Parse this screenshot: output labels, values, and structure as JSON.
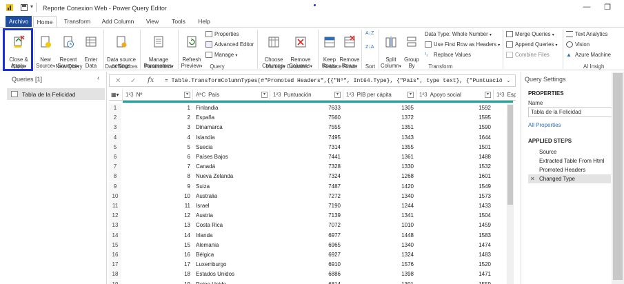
{
  "window": {
    "title": "Reporte Conexion Web - Power Query Editor"
  },
  "menu": {
    "tabs": [
      "Archivo",
      "Home",
      "Transform",
      "Add Column",
      "View",
      "Tools",
      "Help"
    ]
  },
  "ribbon": {
    "close_apply": "Close &\nApply",
    "new_source": "New\nSource",
    "recent_sources": "Recent\nSources",
    "enter_data": "Enter\nData",
    "data_source_settings": "Data source\nsettings",
    "manage_parameters": "Manage\nParameters",
    "refresh_preview": "Refresh\nPreview",
    "properties": "Properties",
    "advanced_editor": "Advanced Editor",
    "manage": "Manage",
    "choose_columns": "Choose\nColumns",
    "remove_columns": "Remove\nColumns",
    "keep_rows": "Keep\nRows",
    "remove_rows": "Remove\nRows",
    "split_column": "Split\nColumn",
    "group_by": "Group\nBy",
    "data_type": "Data Type: Whole Number",
    "use_first_row": "Use First Row as Headers",
    "replace_values": "Replace Values",
    "merge_queries": "Merge Queries",
    "append_queries": "Append Queries",
    "combine_files": "Combine Files",
    "text_analytics": "Text Analytics",
    "vision": "Vision",
    "azure_ml": "Azure Machine",
    "groups": {
      "close": "Close",
      "new_query": "New Query",
      "data_sources": "Data Sources",
      "parameters": "Parameters",
      "query": "Query",
      "manage_columns": "Manage Columns",
      "reduce_rows": "Reduce Rows",
      "sort": "Sort",
      "transform": "Transform",
      "ai_insights": "AI Insigh"
    }
  },
  "queries_pane": {
    "title": "Queries [1]",
    "items": [
      "Tabla de la Felicidad"
    ]
  },
  "formula_bar": {
    "formula": "= Table.TransformColumnTypes(#\"Promoted Headers\",{{\"Nº\", Int64.Type}, {\"País\", type text}, {\"Puntuación\","
  },
  "grid": {
    "columns": [
      {
        "type": "1²3",
        "name": "Nº"
      },
      {
        "type": "AᵇC",
        "name": "País"
      },
      {
        "type": "1²3",
        "name": "Puntuación"
      },
      {
        "type": "1²3",
        "name": "PIB per cápita"
      },
      {
        "type": "1²3",
        "name": "Apoyo social"
      },
      {
        "type": "1²3",
        "name": "Espe"
      }
    ],
    "rows": [
      [
        "1",
        "1",
        "Finlandia",
        "7633",
        "1305",
        "1592"
      ],
      [
        "2",
        "2",
        "España",
        "7560",
        "1372",
        "1595"
      ],
      [
        "3",
        "3",
        "Dinamarca",
        "7555",
        "1351",
        "1590"
      ],
      [
        "4",
        "4",
        "Islandia",
        "7495",
        "1343",
        "1644"
      ],
      [
        "5",
        "5",
        "Suecia",
        "7314",
        "1355",
        "1501"
      ],
      [
        "6",
        "6",
        "Países Bajos",
        "7441",
        "1361",
        "1488"
      ],
      [
        "7",
        "7",
        "Canadá",
        "7328",
        "1330",
        "1532"
      ],
      [
        "8",
        "8",
        "Nueva Zelanda",
        "7324",
        "1268",
        "1601"
      ],
      [
        "9",
        "9",
        "Suiza",
        "7487",
        "1420",
        "1549"
      ],
      [
        "10",
        "10",
        "Australia",
        "7272",
        "1340",
        "1573"
      ],
      [
        "11",
        "11",
        "Israel",
        "7190",
        "1244",
        "1433"
      ],
      [
        "12",
        "12",
        "Austria",
        "7139",
        "1341",
        "1504"
      ],
      [
        "13",
        "13",
        "Costa Rica",
        "7072",
        "1010",
        "1459"
      ],
      [
        "14",
        "14",
        "Irlanda",
        "6977",
        "1448",
        "1583"
      ],
      [
        "15",
        "15",
        "Alemania",
        "6965",
        "1340",
        "1474"
      ],
      [
        "16",
        "16",
        "Bélgica",
        "6927",
        "1324",
        "1483"
      ],
      [
        "17",
        "17",
        "Luxemburgo",
        "6910",
        "1576",
        "1520"
      ],
      [
        "18",
        "18",
        "Estados Unidos",
        "6886",
        "1398",
        "1471"
      ],
      [
        "19",
        "19",
        "Reino Unido",
        "6814",
        "1301",
        "1559"
      ]
    ]
  },
  "settings": {
    "title": "Query Settings",
    "properties_header": "PROPERTIES",
    "name_label": "Name",
    "name_value": "Tabla de la Felicidad",
    "all_properties": "All Properties",
    "steps_header": "APPLIED STEPS",
    "steps": [
      "Source",
      "Extracted Table From Html",
      "Promoted Headers",
      "Changed Type"
    ]
  },
  "colors": {
    "accent": "#1f4e9e",
    "highlight": "#1c2fd6",
    "column_bar": "#1fa89a"
  }
}
